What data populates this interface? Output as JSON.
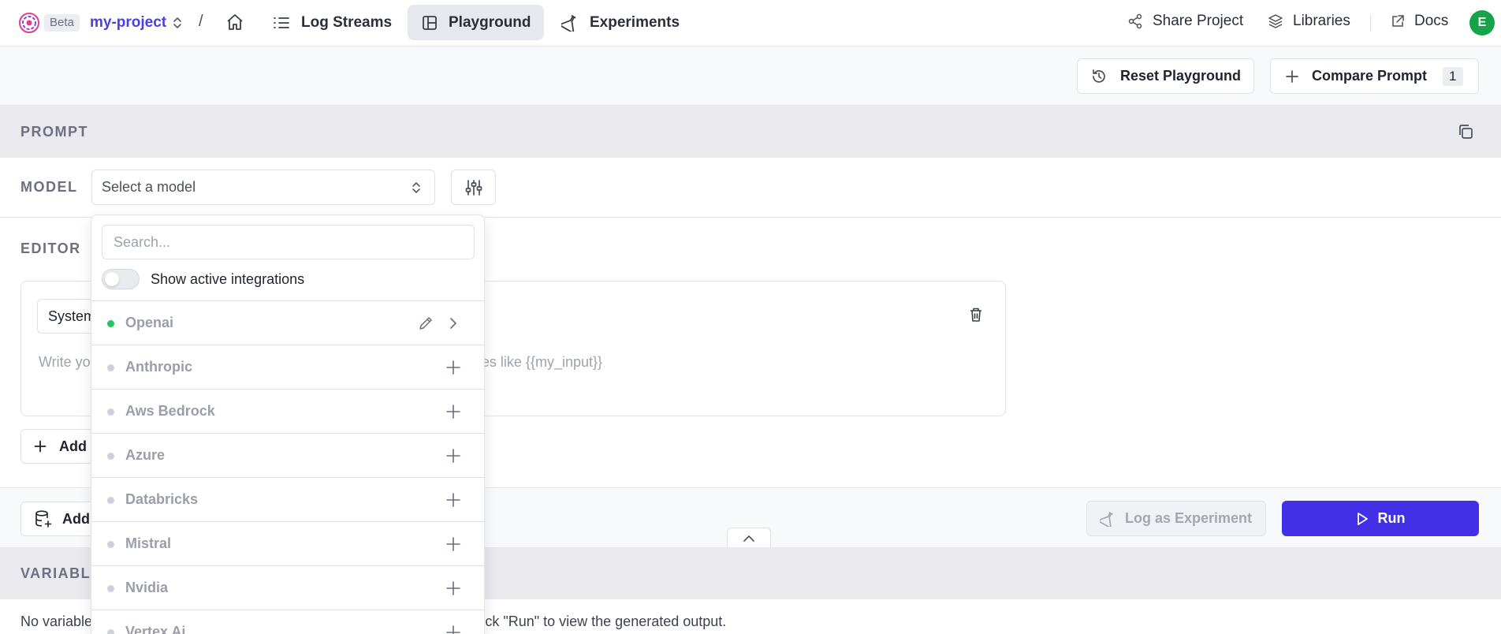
{
  "nav": {
    "beta": "Beta",
    "project": "my-project",
    "slash": "/",
    "tabs": [
      {
        "label": "Log Streams"
      },
      {
        "label": "Playground"
      },
      {
        "label": "Experiments"
      }
    ],
    "share": "Share Project",
    "libraries": "Libraries",
    "docs": "Docs",
    "avatar_initial": "E"
  },
  "toolbar": {
    "reset": "Reset Playground",
    "compare": "Compare Prompt",
    "compare_count": "1"
  },
  "prompt": {
    "heading": "PROMPT",
    "model_label": "MODEL",
    "model_placeholder": "Select a model",
    "editor_label": "EDITOR",
    "role": "System",
    "message_placeholder": "Write your system prompt here. Use double curly braces to add variables like {{my_input}}",
    "add_message": "Add Message"
  },
  "run_bar": {
    "add_dataset": "Add Dataset",
    "log_experiment": "Log as Experiment",
    "run": "Run"
  },
  "variables": {
    "heading": "VARIABLES",
    "empty_text": "No variables defined. Add variables to your prompt, fill in the inputs and click \"Run\" to view the generated output."
  },
  "dropdown": {
    "search_placeholder": "Search...",
    "toggle_label": "Show active integrations",
    "providers": [
      {
        "name": "Openai",
        "active": true
      },
      {
        "name": "Anthropic",
        "active": false
      },
      {
        "name": "Aws Bedrock",
        "active": false
      },
      {
        "name": "Azure",
        "active": false
      },
      {
        "name": "Databricks",
        "active": false
      },
      {
        "name": "Mistral",
        "active": false
      },
      {
        "name": "Nvidia",
        "active": false
      },
      {
        "name": "Vertex Ai",
        "active": false
      }
    ]
  },
  "colors": {
    "accent": "#4330e6",
    "project_link": "#4a3ee6",
    "active_dot": "#22c55e",
    "avatar": "#16a34a"
  }
}
